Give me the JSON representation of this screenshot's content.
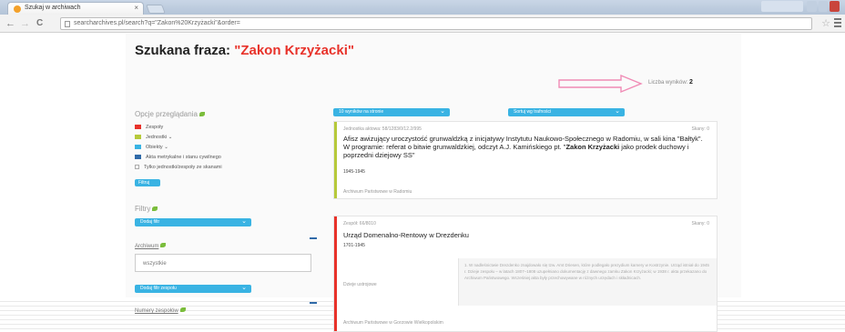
{
  "browser": {
    "tab_title": "Szukaj w archiwach",
    "tab_close": "×",
    "url": "searcharchives.pl/search?q=\"Zakon%20Krzyżacki\"&order=",
    "back": "←",
    "forward": "→",
    "reload": "C",
    "star": "☆"
  },
  "header": {
    "label": "Szukana fraza: ",
    "phrase": "\"Zakon Krzyżacki\""
  },
  "results_count": {
    "label": "Liczba wyników: ",
    "value": "2"
  },
  "toolbar": {
    "per_page": "10 wyników na stronie",
    "sort": "Sortuj wg trafności"
  },
  "options": {
    "title": "Opcje przeglądania",
    "items": [
      {
        "label": "Zespoły",
        "color": "#e8322a"
      },
      {
        "label": "Jednostki",
        "color": "#b6c93a"
      },
      {
        "label": "Obiekty",
        "color": "#39b3e3"
      },
      {
        "label": "Akta metrykalne i stanu cywilnego",
        "color": "#2f6aa8"
      }
    ],
    "only_scans": "Tylko jednostki/zespoły ze skanami",
    "filter_button": "Filtruj"
  },
  "filters": {
    "title": "Filtry",
    "add_filter": "Dodaj filtr",
    "archive_label": "Archiwum",
    "archive_value": "wszystkie",
    "add_filter_zespol": "Dodaj filtr zespołu",
    "zespol_numbers_label": "Numery zespołów"
  },
  "results": [
    {
      "meta": "Jednostka aktowa: 58/1283/0/12.2/995",
      "scans": "Skany: 0",
      "title_plain": "Afisz awizujący uroczystość grunwaldzką z inicjatywy Instytutu Naukowo-Społecznego w Radomiu, w sali kina \"Bałtyk\". W programie: referat o bitwie grunwaldzkiej, odczyt A.J. Kamińskiego pt. \"",
      "title_bold": "Zakon Krzyżacki",
      "title_end": " jako prodek duchowy i poprzedni dziejowy SS\"",
      "years": "1945-1945",
      "archive": "Archiwum Państwowe w Radomiu",
      "color": "#b6c93a"
    },
    {
      "meta": "Zespół: 66/8010",
      "scans": "Skany: 0",
      "title": "Urząd Domenalno-Rentowy w Drezdenku",
      "years": "1701-1945",
      "desc_label": "Dzieje ustrojowe",
      "desc": "1. W nadleśnictwie Drezdenko znajdowało się tzw. Amt Driesen, które podlegało prezydium kamery w Kostrzynie. Urząd istniał do 1945 r. Dzieje zespołu – w latach 1807–1808 uzupełniano dokumentację z dawnego zamku Zakon Krzyżacki; w 1938 r. akta przekazano do Archiwum Państwowego. Wcześniej akta były przechowywane w różnych urzędach i składnicach.",
      "archive": "Archiwum Państwowe w Gorzowie Wielkopolskim",
      "color": "#e8322a"
    }
  ],
  "icons": [
    "favicon-icon",
    "page-icon",
    "star-icon",
    "menu-icon",
    "leaf-icon",
    "chevron-down-icon",
    "minus-icon",
    "pink-arrow-icon"
  ]
}
